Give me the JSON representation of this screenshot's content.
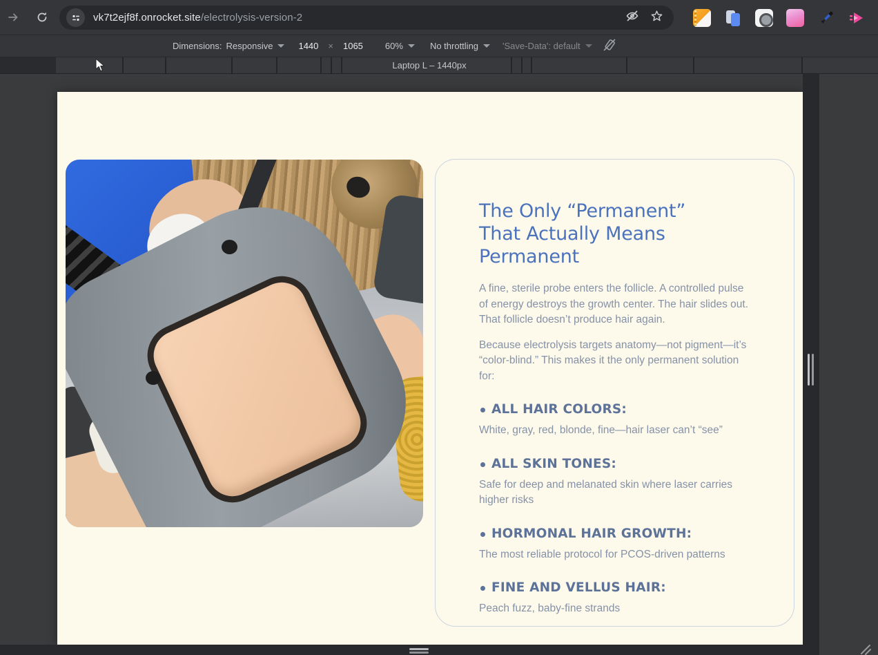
{
  "browser": {
    "url": {
      "domain": "vk7t2ejf8f.onrocket.site",
      "path": "/electrolysis-version-2"
    },
    "icons": [
      "forward-icon",
      "reload-icon",
      "site-info-icon",
      "hide-preview-icon",
      "bookmark-star-icon",
      "notes-extension-icon",
      "clipboard-extension-icon",
      "camera-extension-icon",
      "palette-extension-icon",
      "eyedropper-extension-icon",
      "video-speed-extension-icon"
    ]
  },
  "device_toolbar": {
    "dimensions_label": "Dimensions:",
    "mode": "Responsive",
    "width_value": "1440",
    "multiply": "×",
    "height_value": "1065",
    "zoom_value": "60%",
    "throttle_value": "No throttling",
    "save_data_value": "'Save-Data': default",
    "rotate_icon": "rotate-disabled-icon"
  },
  "breakpoints": {
    "active_label": "Laptop L – 1440px"
  },
  "content": {
    "heading": "The Only “Permanent” That Actually Means Permanent",
    "paragraphs": [
      "A fine, sterile probe enters the follicle. A controlled pulse of energy destroys the growth center. The hair slides out. That follicle doesn’t produce hair again.",
      "Because electrolysis targets anatomy—not pigment—it’s “color-blind.” This makes it the only permanent solution for:"
    ],
    "bullets": [
      {
        "heading": "ALL HAIR COLORS:",
        "text": "White, gray, red, blonde, fine—hair laser can’t “see”"
      },
      {
        "heading": "ALL SKIN TONES:",
        "text": "Safe for deep and melanated skin where laser carries higher risks"
      },
      {
        "heading": "HORMONAL HAIR GROWTH:",
        "text": "The most reliable protocol for PCOS-driven patterns"
      },
      {
        "heading": "FINE AND VELLUS HAIR:",
        "text": "Peach fuzz, baby-fine strands"
      }
    ],
    "image_alt": "Electrologist in blue scrubs treating a client with a gray magnifier device"
  },
  "colors": {
    "accent_blue": "#4b72bd",
    "bullet_heading": "#5d7298",
    "body_text": "#8591a7",
    "page_background": "#fdfaeb",
    "card_border": "#cdd5df",
    "chrome_dark": "#35363a"
  }
}
